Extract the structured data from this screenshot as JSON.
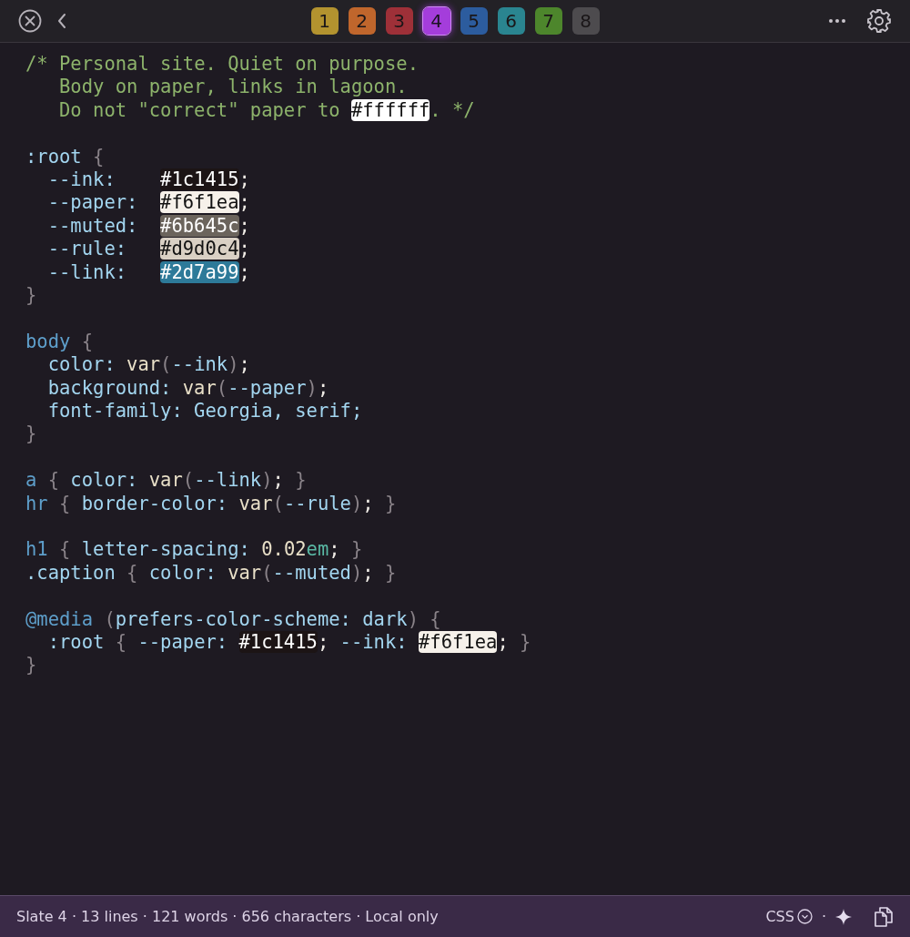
{
  "toolbar": {
    "tabs": [
      {
        "label": "1",
        "color": "#b3932f",
        "selected": false
      },
      {
        "label": "2",
        "color": "#c0662c",
        "selected": false
      },
      {
        "label": "3",
        "color": "#9e3038",
        "selected": false
      },
      {
        "label": "4",
        "color": "#a43ddb",
        "selected": true
      },
      {
        "label": "5",
        "color": "#2c5c9e",
        "selected": false
      },
      {
        "label": "6",
        "color": "#2a8590",
        "selected": false
      },
      {
        "label": "7",
        "color": "#4d862c",
        "selected": false
      },
      {
        "label": "8",
        "color": "#4d4b4e",
        "selected": false
      }
    ]
  },
  "editor": {
    "lines": [
      {
        "kind": "plain",
        "tokens": [
          {
            "text": "/* Personal site. Quiet on purpose.",
            "kind": "comment"
          }
        ]
      },
      {
        "kind": "comment",
        "tokens": [
          {
            "text": "Body on paper, links in lagoon.",
            "kind": "comment"
          }
        ]
      },
      {
        "kind": "comment",
        "tokens": [
          {
            "text": "Do not \"correct\" paper to ",
            "kind": "comment"
          },
          {
            "text": "#ffffff",
            "kind": "swatch",
            "color": "#ffffff"
          },
          {
            "text": ". */",
            "kind": "comment"
          }
        ]
      },
      {
        "kind": "blank"
      },
      {
        "kind": "plain",
        "tokens": [
          {
            "text": ":root",
            "kind": "prop"
          },
          {
            "text": " {",
            "kind": "punct"
          }
        ]
      },
      {
        "kind": "block",
        "tokens": [
          {
            "text": "--ink:    ",
            "kind": "prop"
          },
          {
            "text": "#1c1415",
            "kind": "swatch",
            "color": "#1c1415"
          },
          {
            "text": ";",
            "kind": "plain"
          }
        ]
      },
      {
        "kind": "block",
        "tokens": [
          {
            "text": "--paper:  ",
            "kind": "prop"
          },
          {
            "text": "#f6f1ea",
            "kind": "swatch",
            "color": "#f6f1ea"
          },
          {
            "text": ";",
            "kind": "plain"
          }
        ]
      },
      {
        "kind": "block",
        "tokens": [
          {
            "text": "--muted:  ",
            "kind": "prop"
          },
          {
            "text": "#6b645c",
            "kind": "swatch",
            "color": "#6b645c"
          },
          {
            "text": ";",
            "kind": "plain"
          }
        ]
      },
      {
        "kind": "block",
        "tokens": [
          {
            "text": "--rule:   ",
            "kind": "prop"
          },
          {
            "text": "#d9d0c4",
            "kind": "swatch",
            "color": "#d9d0c4"
          },
          {
            "text": ";",
            "kind": "plain"
          }
        ]
      },
      {
        "kind": "block",
        "tokens": [
          {
            "text": "--link:   ",
            "kind": "prop"
          },
          {
            "text": "#2d7a99",
            "kind": "swatch",
            "color": "#2d7a99"
          },
          {
            "text": ";",
            "kind": "plain"
          }
        ]
      },
      {
        "kind": "plain",
        "tokens": [
          {
            "text": "}",
            "kind": "punct"
          }
        ]
      },
      {
        "kind": "blank"
      },
      {
        "kind": "plain",
        "tokens": [
          {
            "text": "body",
            "kind": "selector"
          },
          {
            "text": " {",
            "kind": "punct"
          }
        ]
      },
      {
        "kind": "block",
        "tokens": [
          {
            "text": "color:",
            "kind": "prop"
          },
          {
            "text": " var",
            "kind": "func"
          },
          {
            "text": "(",
            "kind": "punct"
          },
          {
            "text": "--ink",
            "kind": "prop"
          },
          {
            "text": ")",
            "kind": "punct"
          },
          {
            "text": ";",
            "kind": "plain"
          }
        ]
      },
      {
        "kind": "block",
        "tokens": [
          {
            "text": "background:",
            "kind": "prop"
          },
          {
            "text": " var",
            "kind": "func"
          },
          {
            "text": "(",
            "kind": "punct"
          },
          {
            "text": "--paper",
            "kind": "prop"
          },
          {
            "text": ")",
            "kind": "punct"
          },
          {
            "text": ";",
            "kind": "plain"
          }
        ]
      },
      {
        "kind": "block",
        "tokens": [
          {
            "text": "font-family: Georgia, serif;",
            "kind": "prop"
          }
        ]
      },
      {
        "kind": "plain",
        "tokens": [
          {
            "text": "}",
            "kind": "punct"
          }
        ]
      },
      {
        "kind": "blank"
      },
      {
        "kind": "plain",
        "tokens": [
          {
            "text": "a",
            "kind": "selector"
          },
          {
            "text": " {",
            "kind": "punct"
          },
          {
            "text": " color:",
            "kind": "prop"
          },
          {
            "text": " var",
            "kind": "func"
          },
          {
            "text": "(",
            "kind": "punct"
          },
          {
            "text": "--link",
            "kind": "prop"
          },
          {
            "text": ")",
            "kind": "punct"
          },
          {
            "text": ";",
            "kind": "plain"
          },
          {
            "text": " }",
            "kind": "punct"
          }
        ]
      },
      {
        "kind": "plain",
        "tokens": [
          {
            "text": "hr",
            "kind": "selector"
          },
          {
            "text": " {",
            "kind": "punct"
          },
          {
            "text": " border-color:",
            "kind": "prop"
          },
          {
            "text": " var",
            "kind": "func"
          },
          {
            "text": "(",
            "kind": "punct"
          },
          {
            "text": "--rule",
            "kind": "prop"
          },
          {
            "text": ")",
            "kind": "punct"
          },
          {
            "text": ";",
            "kind": "plain"
          },
          {
            "text": " }",
            "kind": "punct"
          }
        ]
      },
      {
        "kind": "blank"
      },
      {
        "kind": "plain",
        "tokens": [
          {
            "text": "h1",
            "kind": "selector"
          },
          {
            "text": " {",
            "kind": "punct"
          },
          {
            "text": " letter-spacing:",
            "kind": "prop"
          },
          {
            "text": " 0.02",
            "kind": "number"
          },
          {
            "text": "em",
            "kind": "unit"
          },
          {
            "text": ";",
            "kind": "plain"
          },
          {
            "text": " }",
            "kind": "punct"
          }
        ]
      },
      {
        "kind": "plain",
        "tokens": [
          {
            "text": ".caption",
            "kind": "prop"
          },
          {
            "text": " {",
            "kind": "punct"
          },
          {
            "text": " color:",
            "kind": "prop"
          },
          {
            "text": " var",
            "kind": "func"
          },
          {
            "text": "(",
            "kind": "punct"
          },
          {
            "text": "--muted",
            "kind": "prop"
          },
          {
            "text": ")",
            "kind": "punct"
          },
          {
            "text": ";",
            "kind": "plain"
          },
          {
            "text": " }",
            "kind": "punct"
          }
        ]
      },
      {
        "kind": "blank"
      },
      {
        "kind": "plain",
        "tokens": [
          {
            "text": "@media",
            "kind": "selector"
          },
          {
            "text": " (",
            "kind": "punct"
          },
          {
            "text": "prefers-color-scheme: dark",
            "kind": "prop"
          },
          {
            "text": ")",
            "kind": "punct"
          },
          {
            "text": " {",
            "kind": "punct"
          }
        ]
      },
      {
        "kind": "block",
        "tokens": [
          {
            "text": ":root",
            "kind": "prop"
          },
          {
            "text": " {",
            "kind": "punct"
          },
          {
            "text": " --paper: ",
            "kind": "prop"
          },
          {
            "text": "#1c1415",
            "kind": "swatch",
            "color": "#1c1415"
          },
          {
            "text": ";",
            "kind": "plain"
          },
          {
            "text": " --ink: ",
            "kind": "prop"
          },
          {
            "text": "#f6f1ea",
            "kind": "swatch",
            "color": "#f6f1ea"
          },
          {
            "text": ";",
            "kind": "plain"
          },
          {
            "text": " }",
            "kind": "punct"
          }
        ]
      },
      {
        "kind": "plain",
        "tokens": [
          {
            "text": "}",
            "kind": "punct"
          }
        ]
      }
    ]
  },
  "status_bar": {
    "summary": "Slate 4 · 13 lines · 121 words · 656 characters · Local only",
    "language": "CSS",
    "separator": "·"
  }
}
